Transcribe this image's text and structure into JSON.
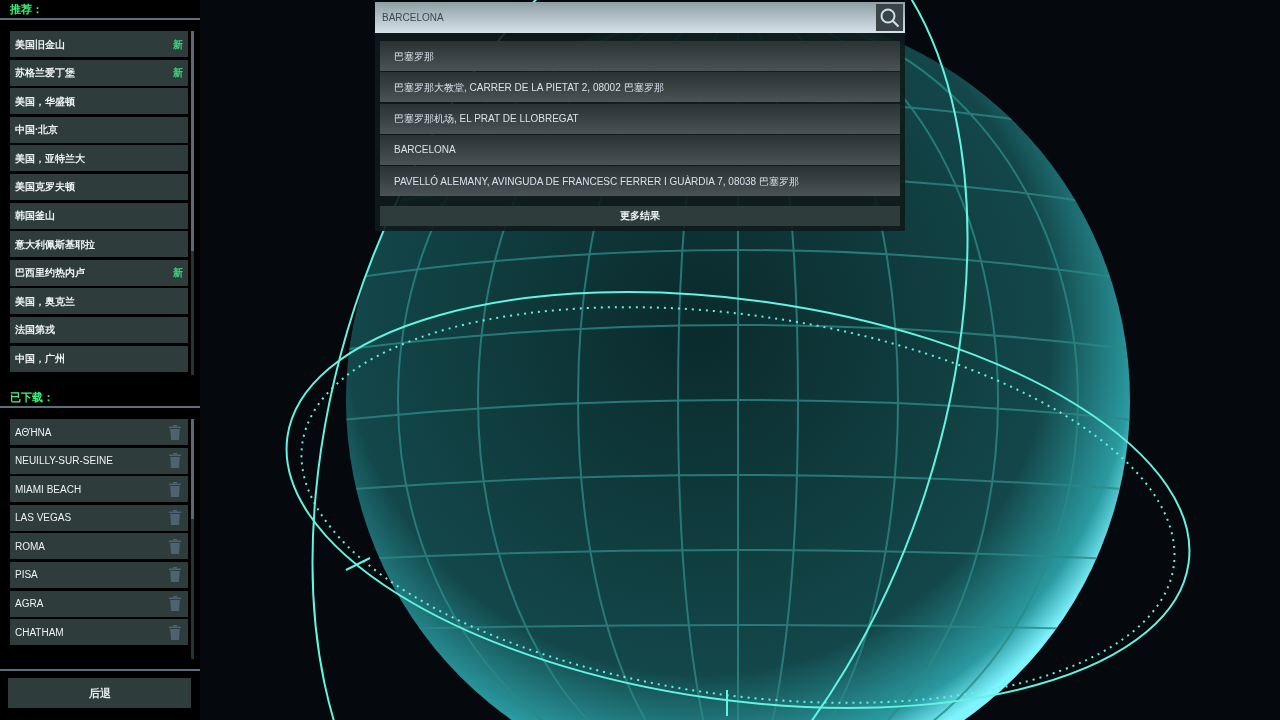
{
  "recommended": {
    "title": "推荐：",
    "items": [
      {
        "label": "美国旧金山",
        "badge": "新"
      },
      {
        "label": "苏格兰爱丁堡",
        "badge": "新"
      },
      {
        "label": "美国，华盛顿"
      },
      {
        "label": "中国·北京"
      },
      {
        "label": "美国，亚特兰大"
      },
      {
        "label": "美国克罗夫顿"
      },
      {
        "label": "韩国釜山"
      },
      {
        "label": "意大利佩斯基耶拉"
      },
      {
        "label": "巴西里约热内卢",
        "badge": "新"
      },
      {
        "label": "美国，奥克兰"
      },
      {
        "label": "法国第戎"
      },
      {
        "label": "中国，广州"
      }
    ]
  },
  "downloaded": {
    "title": "已下载：",
    "items": [
      {
        "label": "ΑΘΉΝΑ"
      },
      {
        "label": "NEUILLY-SUR-SEINE"
      },
      {
        "label": "MIAMI BEACH"
      },
      {
        "label": "LAS VEGAS"
      },
      {
        "label": "ROMA"
      },
      {
        "label": "PISA"
      },
      {
        "label": "AGRA"
      },
      {
        "label": "CHATHAM"
      }
    ]
  },
  "back_button": "后退",
  "search": {
    "value": "BARCELONA"
  },
  "results": [
    "巴塞罗那",
    "巴塞罗那大教堂, CARRER DE LA PIETAT 2, 08002 巴塞罗那",
    "巴塞罗那机场, EL PRAT DE LLOBREGAT",
    "BARCELONA",
    "PAVELLÓ ALEMANY, AVINGUDA DE FRANCESC FERRER I GUÀRDIA 7, 08038 巴塞罗那"
  ],
  "more_results": "更多结果"
}
